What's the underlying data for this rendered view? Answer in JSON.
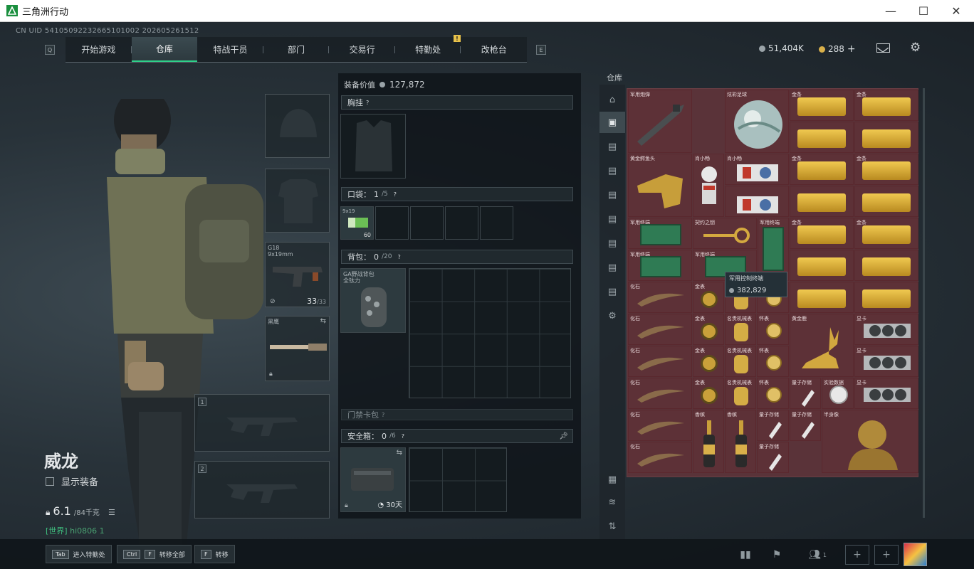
{
  "window": {
    "title": "三角洲行动",
    "minimize": "—",
    "maximize": "☐",
    "close": "✕"
  },
  "uid": "CN UID 54105092232665101002 202605261512",
  "nav": {
    "left_key": "Q",
    "right_key": "E",
    "items": [
      "开始游戏",
      "仓库",
      "特战干员",
      "部门",
      "交易行",
      "特勤处",
      "改枪台"
    ],
    "active": "仓库",
    "badge": "!"
  },
  "currency": {
    "tech_coin": "51,404K",
    "trade_coin": "288",
    "add": "+",
    "coin_color": "#9aa3a8",
    "gold_color": "#d9b04a"
  },
  "character": {
    "name": "威龙",
    "show_equipment": "显示装备",
    "weight": "6.1",
    "weight_max": "/84千克",
    "server": "[世界]",
    "server_suffix": "hi0806 1"
  },
  "equipment": {
    "weapon_label": "G18\n9x19mm",
    "ammo": "33",
    "ammo_max": "/33",
    "melee": "黑鹰",
    "slot1": "1",
    "slot2": "2"
  },
  "middle": {
    "value_label": "装备价值",
    "value": "127,872",
    "chest": "胸挂",
    "help": "?",
    "pocket": "口袋：",
    "pocket_count": "1",
    "pocket_max": "/5",
    "pocket_item": "9x19",
    "pocket_item_count": "60",
    "backpack": "背包：",
    "backpack_count": "0",
    "backpack_max": "/20",
    "backpack_item": "GA野战背包\n全钛力",
    "keycard": "门禁卡包",
    "safe": "安全箱：",
    "safe_count": "0",
    "safe_max": "/6",
    "safe_time": "30天"
  },
  "warehouse": {
    "title": "仓库",
    "tooltip_name": "军用控制终端",
    "tooltip_value": "382,829",
    "labels": [
      "军用炮弹",
      "炫彩足球",
      "金条",
      "黄金鳄鱼头",
      "肖小畅",
      "军用终端",
      "契约之钥",
      "军用终端",
      "化石",
      "金表",
      "怀表",
      "名贵机械表",
      "黄金鹿",
      "显卡",
      "量子存储",
      "实验数据",
      "香槟",
      "半身像"
    ]
  },
  "bottom": {
    "tab_key": "Tab",
    "tab_label": "进入特勤处",
    "ctrl_key": "Ctrl",
    "f_key": "F",
    "transfer_all": "转移全部",
    "f_key2": "F",
    "transfer": "转移",
    "friends": "1"
  }
}
